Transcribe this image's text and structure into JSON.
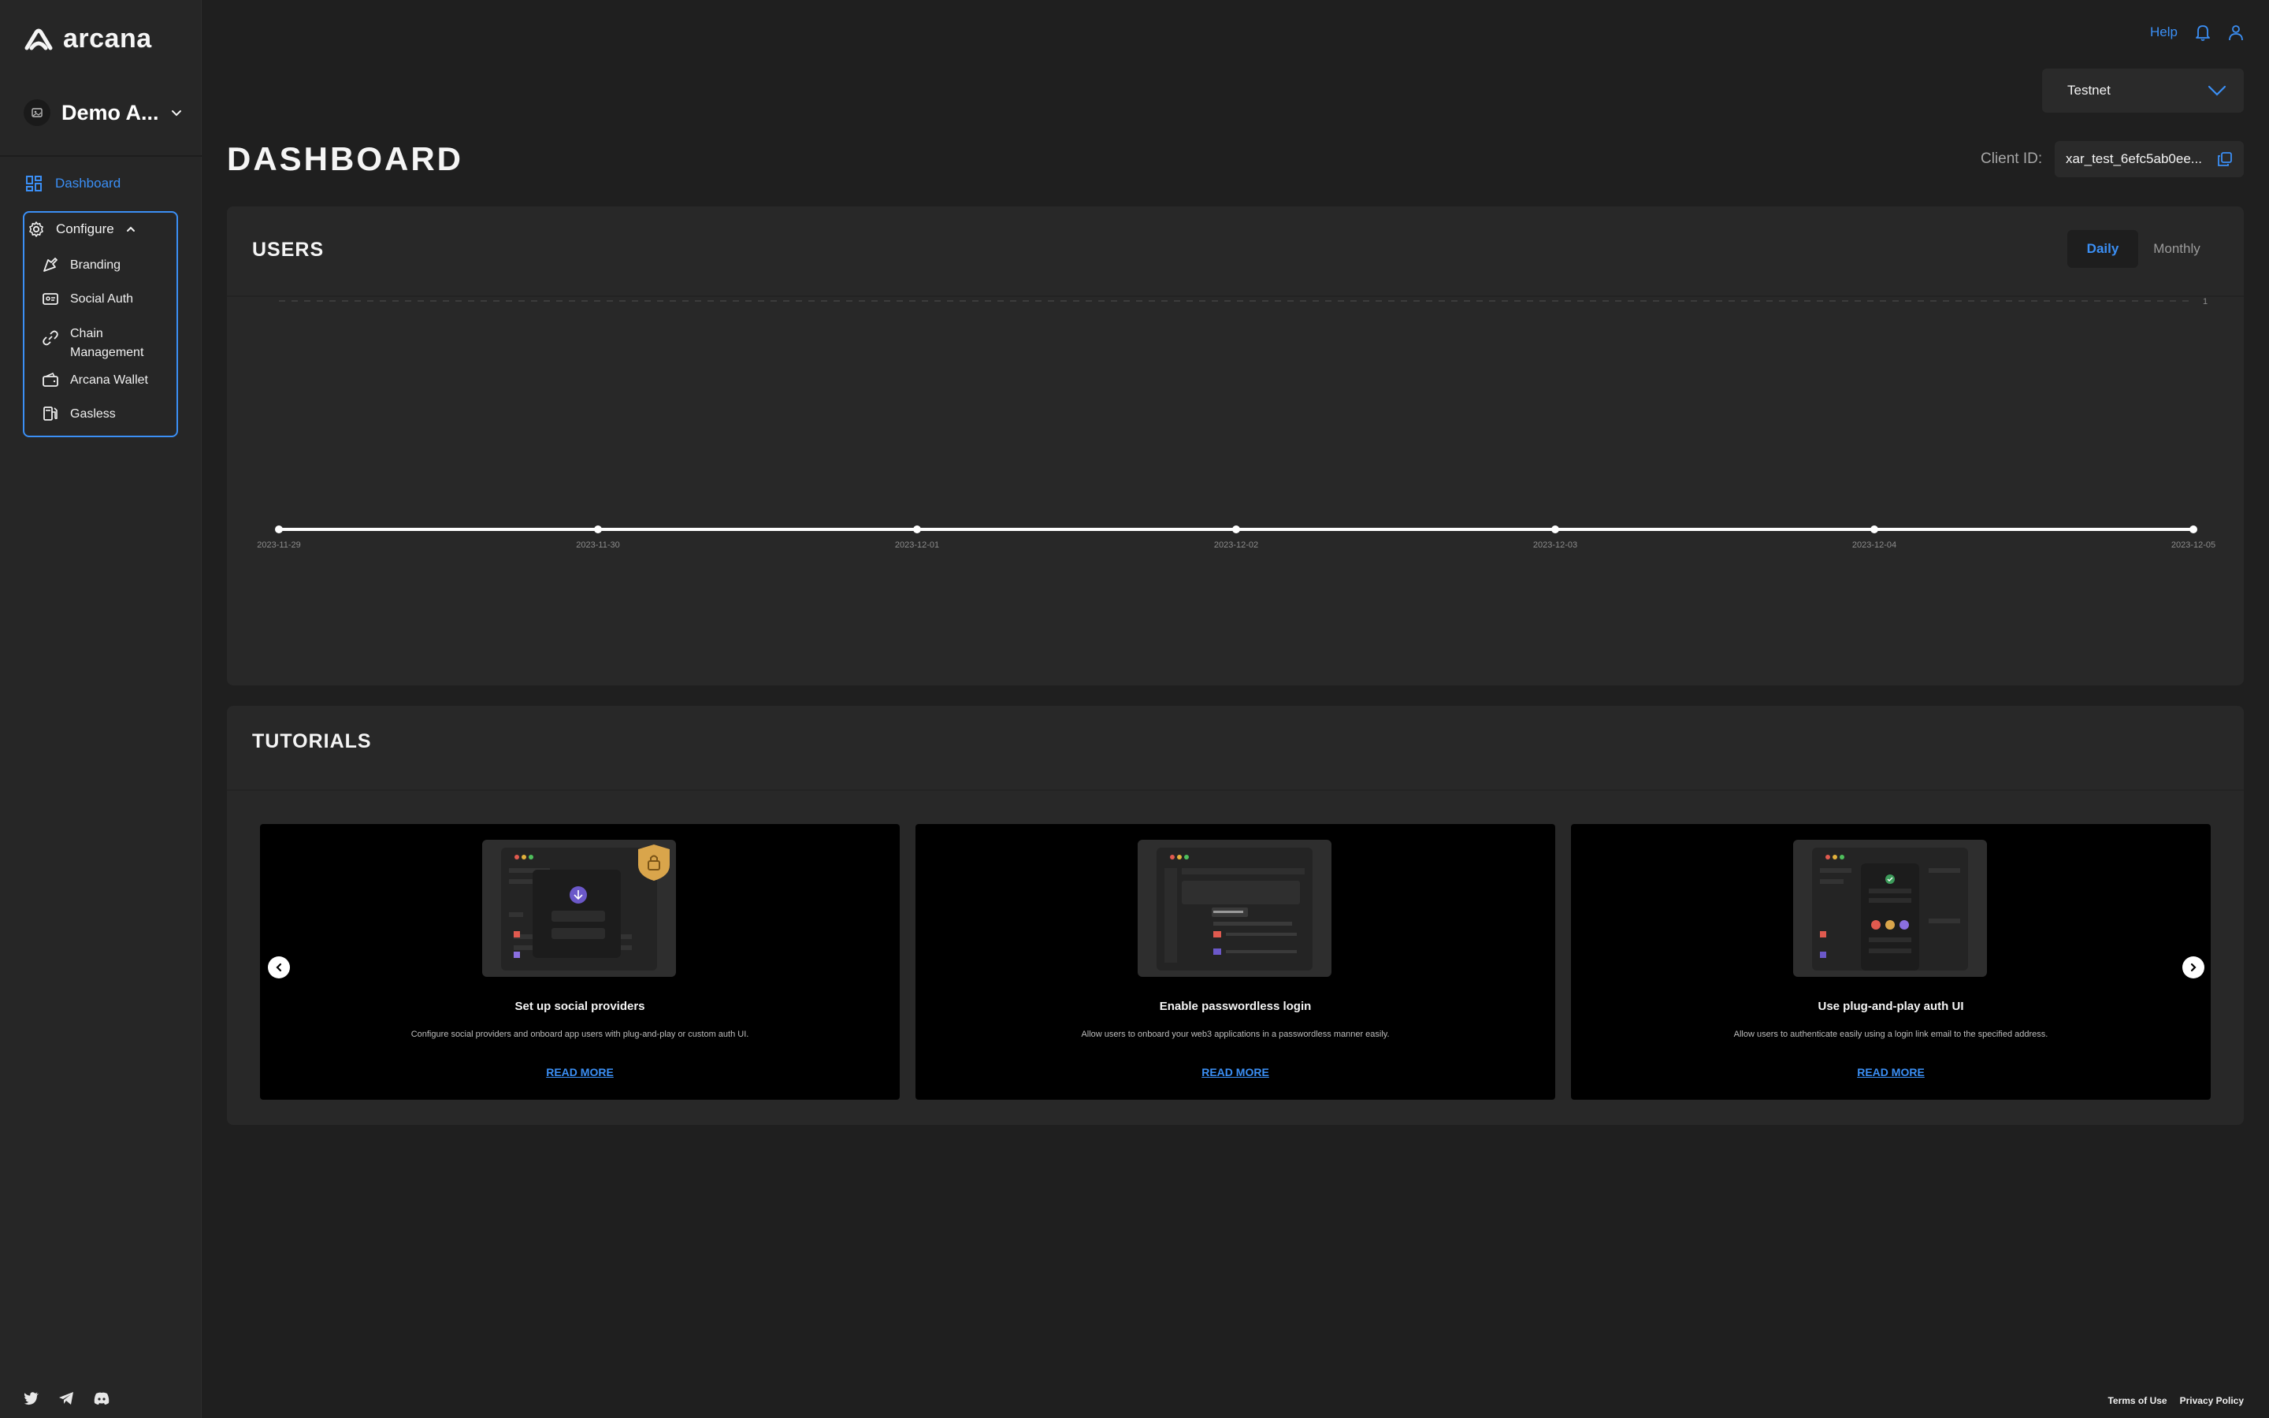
{
  "brand": {
    "name": "arcana",
    "accent": "#3b8ff5"
  },
  "sidebar": {
    "app_name": "Demo A...",
    "dashboard_label": "Dashboard",
    "configure_label": "Configure",
    "items": [
      {
        "label": "Branding",
        "icon": "branding-icon"
      },
      {
        "label": "Social Auth",
        "icon": "id-card-icon"
      },
      {
        "label": "Chain Management",
        "icon": "link-icon"
      },
      {
        "label": "Arcana Wallet",
        "icon": "wallet-icon"
      },
      {
        "label": "Gasless",
        "icon": "fuel-icon"
      }
    ],
    "social": [
      "twitter-icon",
      "telegram-icon",
      "discord-icon"
    ]
  },
  "topbar": {
    "help_label": "Help",
    "network": "Testnet"
  },
  "header": {
    "title": "DASHBOARD",
    "client_id_label": "Client ID:",
    "client_id_value": "xar_test_6efc5ab0ee..."
  },
  "users": {
    "title": "USERS",
    "toggle": {
      "daily": "Daily",
      "monthly": "Monthly",
      "selected": "Daily"
    }
  },
  "chart_data": {
    "type": "line",
    "title": "",
    "xlabel": "",
    "ylabel": "",
    "x": [
      "2023-11-29",
      "2023-11-30",
      "2023-12-01",
      "2023-12-02",
      "2023-12-03",
      "2023-12-04",
      "2023-12-05"
    ],
    "series": [
      {
        "values": [
          0,
          0,
          0,
          0,
          0,
          0,
          0
        ]
      }
    ],
    "y_tick_labels": [
      "1"
    ],
    "ylim": [
      0,
      1
    ],
    "grid": true,
    "line_color": "#ffffff"
  },
  "tutorials": {
    "title": "TUTORIALS",
    "cards": [
      {
        "title": "Set up social providers",
        "description": "Configure social providers and onboard app users with plug-and-play or custom auth UI.",
        "link": "READ MORE"
      },
      {
        "title": "Enable passwordless login",
        "description": "Allow users to onboard your web3 applications in a passwordless manner easily.",
        "link": "READ MORE"
      },
      {
        "title": "Use plug-and-play auth UI",
        "description": "Allow users to authenticate easily using a login link email to the specified address.",
        "link": "READ MORE"
      }
    ]
  },
  "footer": {
    "terms": "Terms of Use",
    "privacy": "Privacy Policy"
  }
}
